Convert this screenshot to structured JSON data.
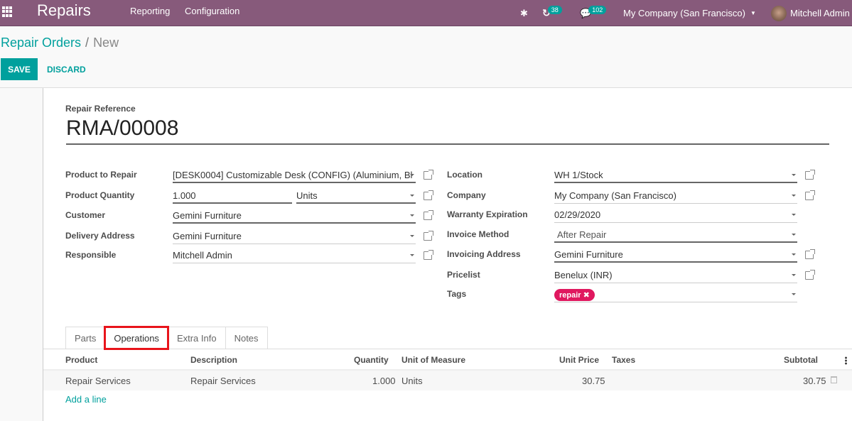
{
  "navbar": {
    "app_name": "Repairs",
    "menu": [
      "Reporting",
      "Configuration"
    ],
    "activity_count": "38",
    "message_count": "102",
    "company": "My Company (San Francisco)",
    "user": "Mitchell Admin"
  },
  "breadcrumb": {
    "parent": "Repair Orders",
    "separator": "/",
    "current": "New"
  },
  "buttons": {
    "save": "SAVE",
    "discard": "DISCARD"
  },
  "form": {
    "reference_label": "Repair Reference",
    "reference_value": "RMA/00008",
    "left_fields": {
      "product_label": "Product to Repair",
      "product_value": "[DESK0004] Customizable Desk (CONFIG) (Aluminium, Bl",
      "quantity_label": "Product Quantity",
      "quantity_value": "1.000",
      "uom_value": "Units",
      "customer_label": "Customer",
      "customer_value": "Gemini Furniture",
      "delivery_label": "Delivery Address",
      "delivery_value": "Gemini Furniture",
      "responsible_label": "Responsible",
      "responsible_value": "Mitchell Admin"
    },
    "right_fields": {
      "location_label": "Location",
      "location_value": "WH 1/Stock",
      "company_label": "Company",
      "company_value": "My Company (San Francisco)",
      "warranty_label": "Warranty Expiration",
      "warranty_value": "02/29/2020",
      "invoice_method_label": "Invoice Method",
      "invoice_method_value": "After Repair",
      "invoicing_address_label": "Invoicing Address",
      "invoicing_address_value": "Gemini Furniture",
      "pricelist_label": "Pricelist",
      "pricelist_value": "Benelux (INR)",
      "tags_label": "Tags",
      "tags": [
        "repair"
      ]
    }
  },
  "tabs": [
    "Parts",
    "Operations",
    "Extra Info",
    "Notes"
  ],
  "active_tab": "Operations",
  "table": {
    "columns": [
      "Product",
      "Description",
      "Quantity",
      "Unit of Measure",
      "Unit Price",
      "Taxes",
      "Subtotal"
    ],
    "rows": [
      {
        "product": "Repair Services",
        "description": "Repair Services",
        "quantity": "1.000",
        "uom": "Units",
        "unit_price": "30.75",
        "taxes": "",
        "subtotal": "30.75"
      }
    ],
    "add_line": "Add a line"
  }
}
